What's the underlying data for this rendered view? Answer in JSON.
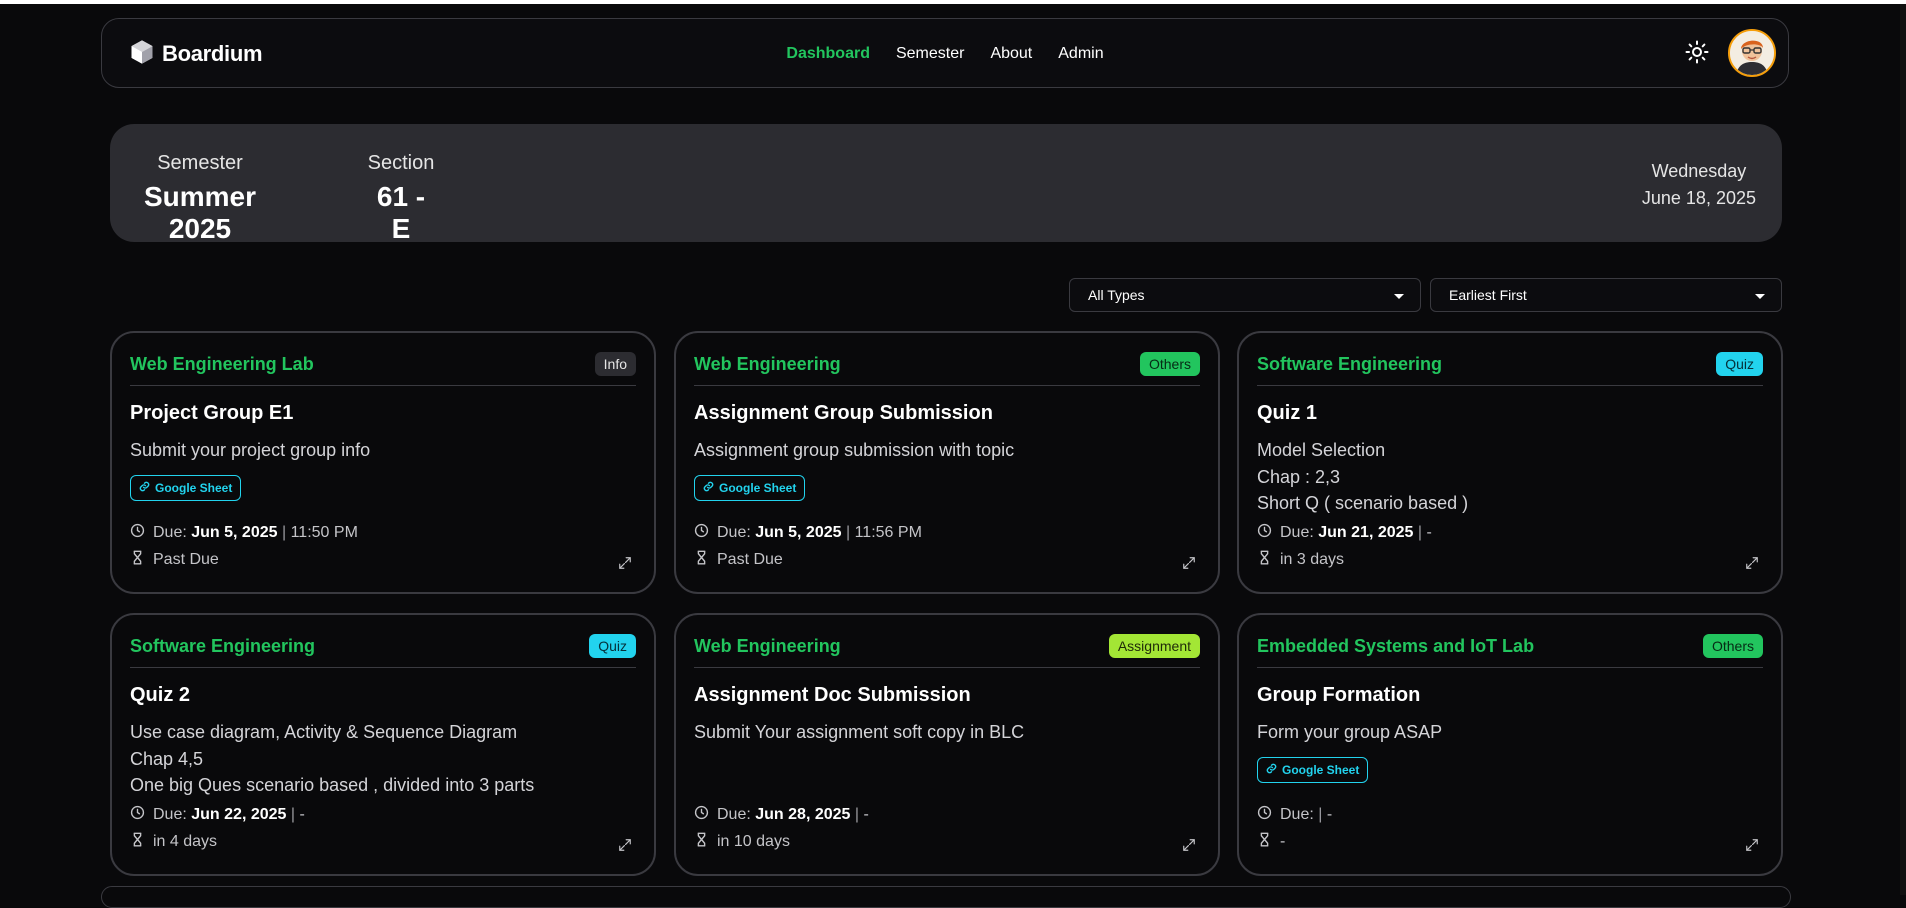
{
  "brand": {
    "name": "Boardium"
  },
  "nav": {
    "links": [
      {
        "label": "Dashboard",
        "active": true
      },
      {
        "label": "Semester",
        "active": false
      },
      {
        "label": "About",
        "active": false
      },
      {
        "label": "Admin",
        "active": false
      }
    ]
  },
  "semester": {
    "semester_label": "Semester",
    "semester_value": "Summer 2025",
    "section_label": "Section",
    "section_value": "61 - E",
    "weekday": "Wednesday",
    "date": "June 18, 2025"
  },
  "filters": {
    "type_selected": "All Types",
    "sort_selected": "Earliest First"
  },
  "colors": {
    "accent": "#22c55e",
    "quiz": "#22d3ee",
    "assignment": "#a3e635",
    "panel": "#2c2c31",
    "background": "#09090b"
  },
  "cards": [
    {
      "course": "Web Engineering Lab",
      "badge": "Info",
      "title": "Project Group E1",
      "desc": [
        "Submit your project group info"
      ],
      "link": "Google Sheet",
      "due_prefix": "Due:",
      "due_date": "Jun 5, 2025",
      "due_sep": "|",
      "due_time": "11:50 PM",
      "status": "Past Due"
    },
    {
      "course": "Web Engineering",
      "badge": "Others",
      "title": "Assignment Group Submission",
      "desc": [
        "Assignment group submission with topic"
      ],
      "link": "Google Sheet",
      "due_prefix": "Due:",
      "due_date": "Jun 5, 2025",
      "due_sep": "|",
      "due_time": "11:56 PM",
      "status": "Past Due"
    },
    {
      "course": "Software Engineering",
      "badge": "Quiz",
      "title": "Quiz 1",
      "desc": [
        "Model Selection",
        "Chap : 2,3",
        "Short Q ( scenario based )"
      ],
      "link": "",
      "due_prefix": "Due:",
      "due_date": "Jun 21, 2025",
      "due_sep": "|",
      "due_time": "-",
      "status": "in 3 days"
    },
    {
      "course": "Software Engineering",
      "badge": "Quiz",
      "title": "Quiz 2",
      "desc": [
        "Use case diagram, Activity & Sequence Diagram",
        "Chap 4,5",
        "One big Ques scenario based , divided into 3 parts"
      ],
      "link": "",
      "due_prefix": "Due:",
      "due_date": "Jun 22, 2025",
      "due_sep": "|",
      "due_time": "-",
      "status": "in 4 days"
    },
    {
      "course": "Web Engineering",
      "badge": "Assignment",
      "title": "Assignment Doc Submission",
      "desc": [
        "Submit Your assignment soft copy in BLC"
      ],
      "link": "",
      "due_prefix": "Due:",
      "due_date": "Jun 28, 2025",
      "due_sep": "|",
      "due_time": "-",
      "status": "in 10 days"
    },
    {
      "course": "Embedded Systems and IoT Lab",
      "badge": "Others",
      "title": "Group Formation",
      "desc": [
        "Form your group ASAP"
      ],
      "link": "Google Sheet",
      "due_prefix": "Due:",
      "due_date": "",
      "due_sep": "|",
      "due_time": "-",
      "status": "-"
    }
  ],
  "icons": {
    "logo": "cube-icon",
    "theme": "sun-icon",
    "due": "clock-icon",
    "status": "hourglass-icon",
    "link": "link-icon",
    "expand": "expand-icon"
  }
}
